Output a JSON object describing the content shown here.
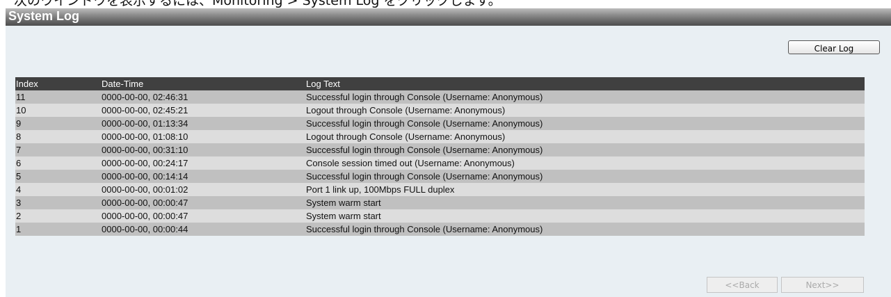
{
  "caption": "次のウインドウを表示するには、Monitoring > System Log をクリックします。",
  "header": {
    "title": "System Log"
  },
  "actions": {
    "clear_label": "Clear Log"
  },
  "table": {
    "columns": [
      "Index",
      "Date-Time",
      "Log Text"
    ],
    "rows": [
      {
        "index": "11",
        "datetime": "0000-00-00, 02:46:31",
        "text": "Successful login through Console (Username: Anonymous)"
      },
      {
        "index": "10",
        "datetime": "0000-00-00, 02:45:21",
        "text": "Logout through Console (Username: Anonymous)"
      },
      {
        "index": "9",
        "datetime": "0000-00-00, 01:13:34",
        "text": "Successful login through Console (Username: Anonymous)"
      },
      {
        "index": "8",
        "datetime": "0000-00-00, 01:08:10",
        "text": "Logout through Console (Username: Anonymous)"
      },
      {
        "index": "7",
        "datetime": "0000-00-00, 00:31:10",
        "text": "Successful login through Console (Username: Anonymous)"
      },
      {
        "index": "6",
        "datetime": "0000-00-00, 00:24:17",
        "text": "Console session timed out (Username: Anonymous)"
      },
      {
        "index": "5",
        "datetime": "0000-00-00, 00:14:14",
        "text": "Successful login through Console (Username: Anonymous)"
      },
      {
        "index": "4",
        "datetime": "0000-00-00, 00:01:02",
        "text": "Port 1 link up, 100Mbps FULL duplex"
      },
      {
        "index": "3",
        "datetime": "0000-00-00, 00:00:47",
        "text": "System warm start"
      },
      {
        "index": "2",
        "datetime": "0000-00-00, 00:00:47",
        "text": "System warm start"
      },
      {
        "index": "1",
        "datetime": "0000-00-00, 00:00:44",
        "text": "Successful login through Console (Username: Anonymous)"
      }
    ]
  },
  "pagination": {
    "back_label": "<<Back",
    "next_label": "Next>>"
  }
}
